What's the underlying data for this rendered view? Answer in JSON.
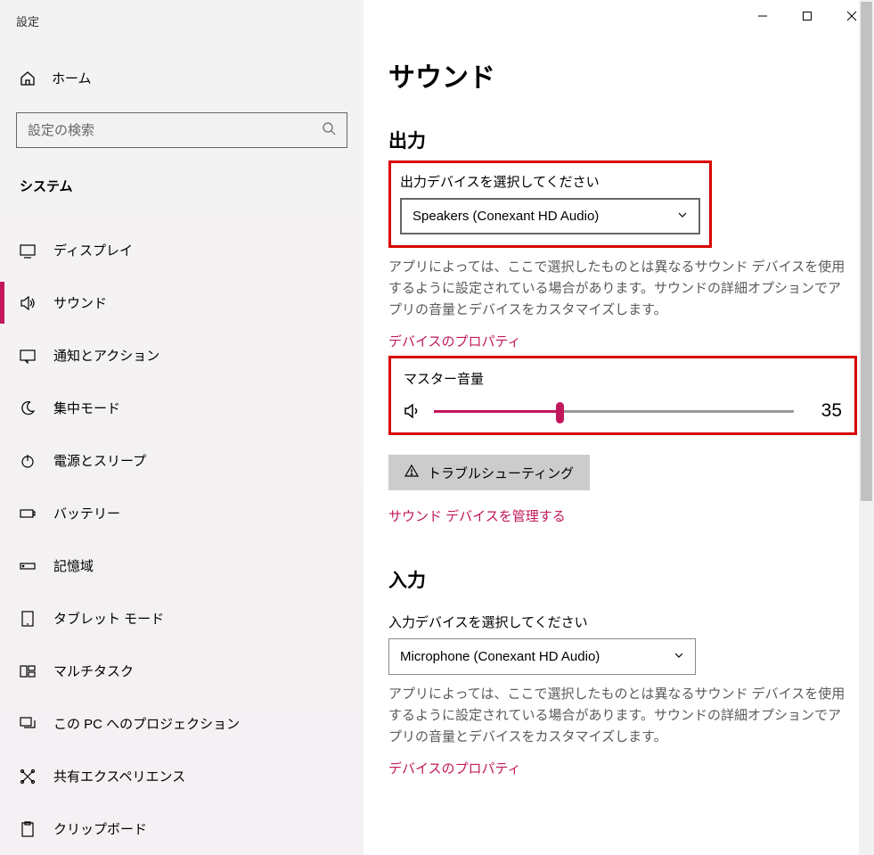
{
  "window": {
    "title": "設定"
  },
  "sidebar": {
    "home": "ホーム",
    "search_placeholder": "設定の検索",
    "category": "システム",
    "items": [
      {
        "label": "ディスプレイ"
      },
      {
        "label": "サウンド"
      },
      {
        "label": "通知とアクション"
      },
      {
        "label": "集中モード"
      },
      {
        "label": "電源とスリープ"
      },
      {
        "label": "バッテリー"
      },
      {
        "label": "記憶域"
      },
      {
        "label": "タブレット モード"
      },
      {
        "label": "マルチタスク"
      },
      {
        "label": "この PC へのプロジェクション"
      },
      {
        "label": "共有エクスペリエンス"
      },
      {
        "label": "クリップボード"
      }
    ]
  },
  "main": {
    "page_title": "サウンド",
    "output": {
      "heading": "出力",
      "choose_label": "出力デバイスを選択してください",
      "device": "Speakers (Conexant HD Audio)",
      "note": "アプリによっては、ここで選択したものとは異なるサウンド デバイスを使用するように設定されている場合があります。サウンドの詳細オプションでアプリの音量とデバイスをカスタマイズします。",
      "props_link": "デバイスのプロパティ",
      "master_label": "マスター音量",
      "volume": "35",
      "troubleshoot": "トラブルシューティング",
      "manage_link": "サウンド デバイスを管理する"
    },
    "input": {
      "heading": "入力",
      "choose_label": "入力デバイスを選択してください",
      "device": "Microphone (Conexant HD Audio)",
      "note": "アプリによっては、ここで選択したものとは異なるサウンド デバイスを使用するように設定されている場合があります。サウンドの詳細オプションでアプリの音量とデバイスをカスタマイズします。",
      "props_link": "デバイスのプロパティ"
    }
  }
}
